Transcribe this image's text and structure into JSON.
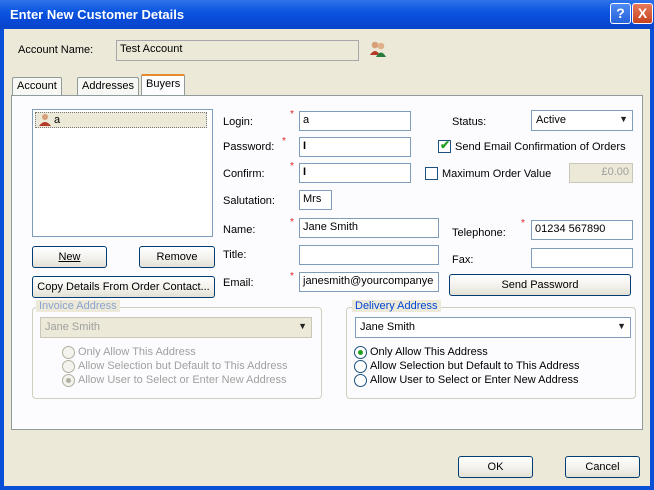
{
  "window": {
    "title": "Enter New Customer Details",
    "help": "?",
    "close": "X"
  },
  "account": {
    "label": "Account Name:",
    "value": "Test Account"
  },
  "tabs": [
    "Account",
    "Addresses",
    "Buyers"
  ],
  "buyers": {
    "list": [
      {
        "name": "a"
      }
    ],
    "new_label": "New",
    "remove_label": "Remove",
    "copy_label": "Copy Details From Order Contact..."
  },
  "form": {
    "login_label": "Login:",
    "login_value": "a",
    "password_label": "Password:",
    "password_value": "I",
    "confirm_label": "Confirm:",
    "confirm_value": "I",
    "salutation_label": "Salutation:",
    "salutation_value": "Mrs",
    "name_label": "Name:",
    "name_value": "Jane Smith",
    "title_label": "Title:",
    "title_value": "",
    "email_label": "Email:",
    "email_value": "janesmith@yourcompanye",
    "status_label": "Status:",
    "status_value": "Active",
    "send_email_label": "Send Email Confirmation of Orders",
    "send_email_checked": true,
    "max_order_label": "Maximum Order Value",
    "max_order_checked": false,
    "max_order_value": "£0.00",
    "telephone_label": "Telephone:",
    "telephone_value": "01234 567890",
    "fax_label": "Fax:",
    "fax_value": "",
    "send_password_label": "Send Password"
  },
  "invoice": {
    "title": "Invoice Address",
    "selected": "Jane Smith",
    "options": [
      "Only Allow This Address",
      "Allow Selection but Default to This Address",
      "Allow User to Select or Enter New Address"
    ],
    "selected_option": 2,
    "enabled": false
  },
  "delivery": {
    "title": "Delivery Address",
    "selected": "Jane Smith",
    "options": [
      "Only Allow This Address",
      "Allow Selection but Default to This Address",
      "Allow User to Select or Enter New Address"
    ],
    "selected_option": 0,
    "enabled": true
  },
  "footer": {
    "ok_label": "OK",
    "cancel_label": "Cancel"
  },
  "colors": {
    "title_bar": "#0b55e0",
    "dialog_bg": "#ece9d8",
    "required_star": "#e02020",
    "group_title": "#0046d5"
  },
  "icons": {
    "account": "users-icon",
    "buyer": "user-icon"
  }
}
